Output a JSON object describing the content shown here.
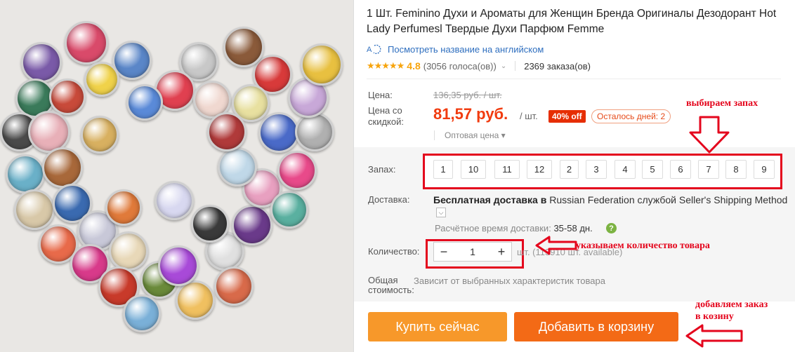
{
  "product": {
    "title": "1 Шт. Feminino Духи и Ароматы для Женщин Бренда Оригиналы Дезодорант Hot Lady Perfumesl Твердые Духи Парфюм Femme",
    "translate_link": "Посмотреть название на английском",
    "translate_icon": "translate-icon",
    "rating": "4.8",
    "votes": "(3056 голоса(ов))",
    "orders": "2369 заказа(ов)",
    "stars": "★★★★★"
  },
  "pricing": {
    "price_label": "Цена:",
    "old_price": "136,35 руб. / шт.",
    "discount_label": "Цена со скидкой:",
    "new_price": "81,57 руб.",
    "per_unit": "/ шт.",
    "discount_badge": "40% off",
    "days_left": "Осталось дней: 2",
    "wholesale": "Оптовая цена ▾"
  },
  "scent": {
    "label": "Запах:",
    "options": [
      "1",
      "10",
      "11",
      "12",
      "2",
      "3",
      "4",
      "5",
      "6",
      "7",
      "8",
      "9"
    ]
  },
  "delivery": {
    "label": "Доставка:",
    "free": "Бесплатная доставка в",
    "destination": "Russian Federation службой Seller's Shipping Method",
    "time_label": "Расчётное время доставки:",
    "time_value": "35-58",
    "time_unit": "дн.",
    "help": "?"
  },
  "quantity": {
    "label": "Количество:",
    "minus": "−",
    "value": "1",
    "plus": "+",
    "available": "шт. (113910 шт. available)"
  },
  "total": {
    "label_line1": "Общая",
    "label_line2": "стоимость:",
    "value": "Зависит от выбранных характеристик товара"
  },
  "actions": {
    "buy_now": "Купить сейчас",
    "add_to_cart": "Добавить в корзину"
  },
  "annotations": {
    "scent_note": "выбираем запах",
    "qty_note": "указываем количество товара",
    "cart_note_line1": "добавляем заказ",
    "cart_note_line2": "в козину"
  },
  "colors": {
    "accent_red": "#e4061d",
    "price_red": "#f13b0f",
    "buy_orange": "#f7982a",
    "cart_orange": "#f36a16",
    "star_gold": "#f7a40c"
  }
}
